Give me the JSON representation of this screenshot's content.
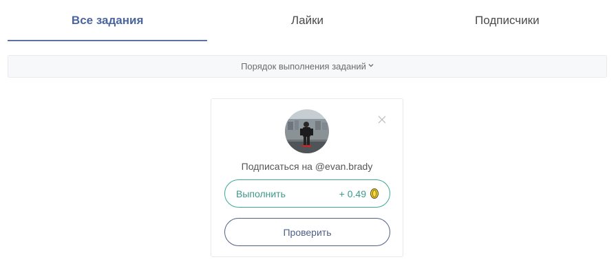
{
  "tabs": [
    {
      "label": "Все задания",
      "active": true
    },
    {
      "label": "Лайки",
      "active": false
    },
    {
      "label": "Подписчики",
      "active": false
    }
  ],
  "order_bar": {
    "label": "Порядок выполнения заданий",
    "icon": "chevron-down-icon"
  },
  "task": {
    "text": "Подписаться на @evan.brady",
    "do_label": "Выполнить",
    "reward": "+ 0.49",
    "check_label": "Проверить"
  },
  "colors": {
    "accent": "#4a64a0",
    "do_button": "#3aa895",
    "check_button": "#4d5f86",
    "coin": "#e8c21a"
  }
}
